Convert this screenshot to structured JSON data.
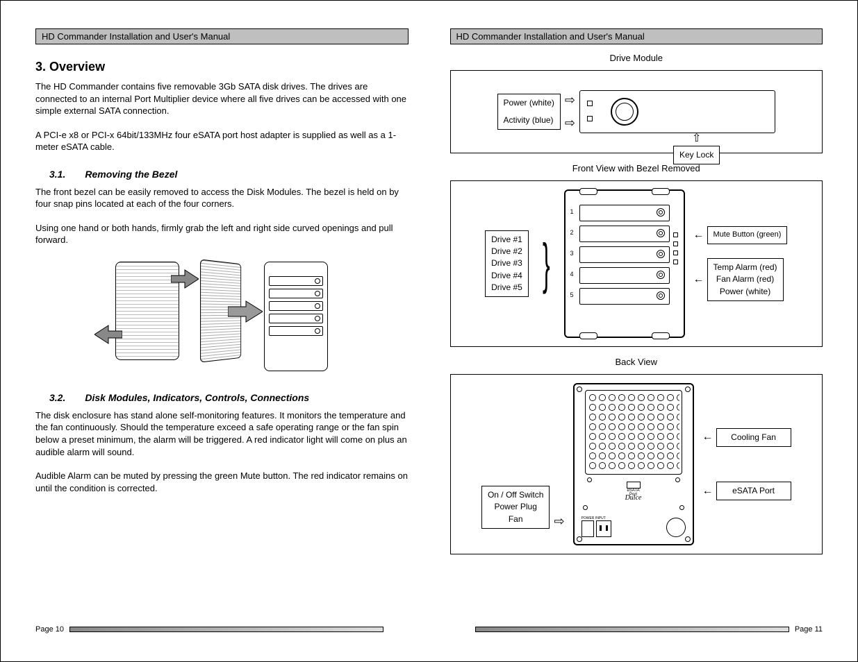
{
  "left": {
    "header": "HD Commander Installation and User's Manual",
    "h_overview": "3. Overview",
    "p_overview1": "The HD Commander contains five removable 3Gb SATA disk drives.  The drives are connected to an internal Port Multiplier device where all five drives can be accessed with one simple external SATA connection.",
    "p_overview2": "A PCI-e x8 or PCI-x 64bit/133MHz four eSATA port host adapter is supplied as well as a 1-meter eSATA cable.",
    "h_31": "3.1.  Removing the Bezel",
    "p_31a": "The front bezel can be easily removed to access the Disk Modules.  The bezel is held on by four snap pins located at each of the four corners.",
    "p_31b": "Using one hand or both hands, firmly grab the left and right side curved openings and pull forward.",
    "h_32": "3.2.  Disk Modules, Indicators, Controls, Connections",
    "p_32a": "The disk enclosure has stand alone self-monitoring features.  It monitors the temperature and the fan continuously.  Should the temperature exceed a safe operating range or the fan spin below a preset minimum, the alarm will be triggered.  A red indicator light will come on plus an audible alarm will sound.",
    "p_32b": "Audible Alarm can be muted by pressing the green Mute button.  The red indicator remains on until the condition is corrected.",
    "footer": "Page 10"
  },
  "right": {
    "header": "HD Commander Installation and User's Manual",
    "drive_module_title": "Drive  Module",
    "dm_power": "Power (white)",
    "dm_activity": "Activity (blue)",
    "dm_keylock": "Key Lock",
    "front_view_title": "Front View with Bezel Removed",
    "drives": [
      "Drive #1",
      "Drive #2",
      "Drive #3",
      "Drive #4",
      "Drive #5"
    ],
    "mute_label": "Mute Button (green)",
    "alarm_labels": [
      "Temp Alarm (red)",
      "Fan Alarm (red)",
      "Power (white)"
    ],
    "back_view_title": "Back View",
    "cooling_fan": "Cooling Fan",
    "esata_port": "eSATA Port",
    "esata_small": "eSATA Port",
    "pwr_text": "POWER INPUT",
    "back_left_labels": [
      "On / Off Switch",
      "Power Plug",
      "Fan"
    ],
    "logo": "Dulce",
    "footer": "Page 11"
  }
}
